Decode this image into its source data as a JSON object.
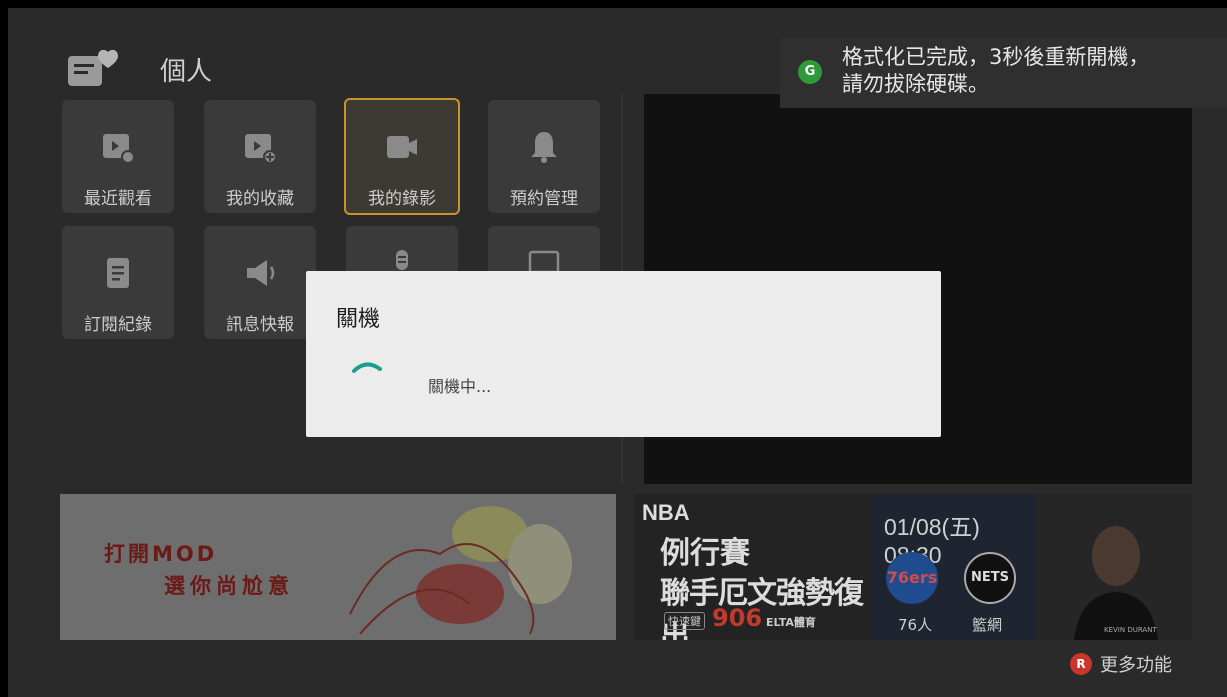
{
  "header": {
    "title": "個人",
    "icon": "personal-icon"
  },
  "tiles": [
    {
      "label": "最近觀看",
      "icon": "recent-play-icon",
      "selected": false
    },
    {
      "label": "我的收藏",
      "icon": "favorite-add-icon",
      "selected": false
    },
    {
      "label": "我的錄影",
      "icon": "video-camera-icon",
      "selected": true
    },
    {
      "label": "預約管理",
      "icon": "bell-icon",
      "selected": false
    },
    {
      "label": "訂閱紀錄",
      "icon": "document-icon",
      "selected": false
    },
    {
      "label": "訊息快報",
      "icon": "megaphone-icon",
      "selected": false
    },
    {
      "label": "",
      "icon": "microphone-icon",
      "selected": false
    },
    {
      "label": "",
      "icon": "monitor-icon",
      "selected": false
    }
  ],
  "toast": {
    "badge": "G",
    "line1": "格式化已完成，3秒後重新開機，",
    "line2": "請勿拔除硬碟。"
  },
  "banner1": {
    "line1": "打開MOD",
    "line2": "選你尚尬意"
  },
  "banner2": {
    "league": "NBA",
    "line1": "例行賽",
    "line2": "聯手厄文強勢復出",
    "hotkey_label": "快速鍵",
    "hotkey_number": "906",
    "channel": "ELTA體育",
    "date_time": "01/08(五) 08:30",
    "team1_logo": "76ers",
    "team2_logo": "NETS",
    "team1": "76人",
    "team2": "籃網",
    "player_caption": "KEVIN DURANT"
  },
  "footer": {
    "button_badge": "R",
    "more_label": "更多功能"
  },
  "dialog": {
    "title": "關機",
    "message": "關機中..."
  },
  "colors": {
    "accent_selected": "#c9952a",
    "spinner": "#1a9e8c",
    "toast_badge": "#2f9a3a",
    "red_button": "#c8362c"
  }
}
